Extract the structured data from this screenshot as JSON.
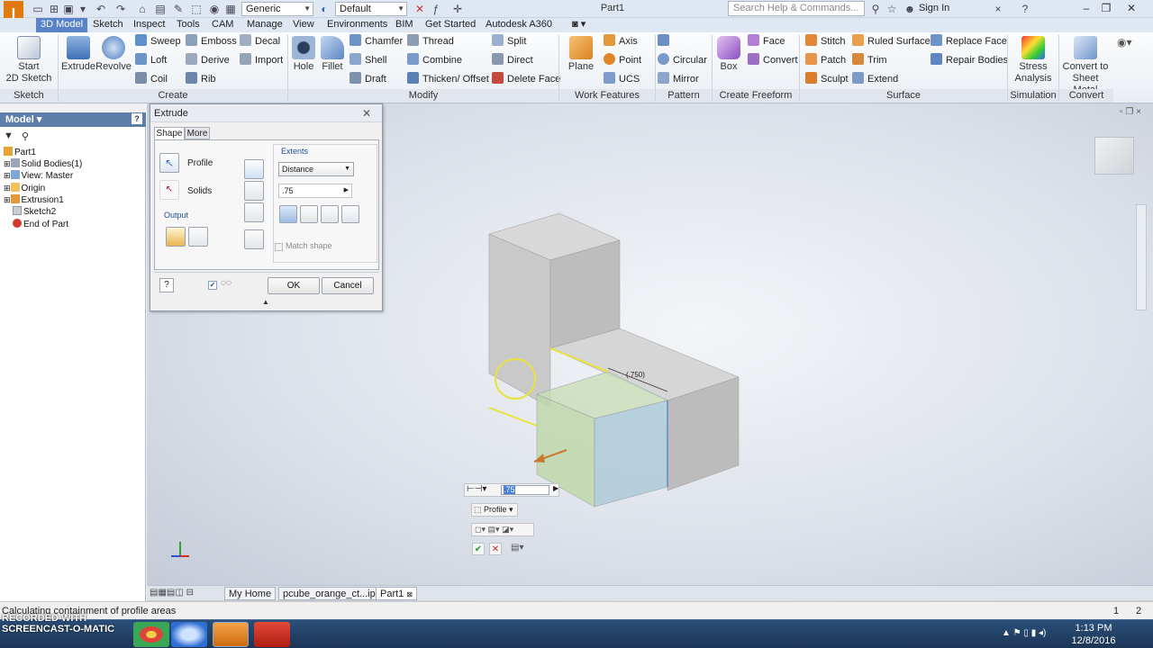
{
  "window": {
    "title": "Part1",
    "logo_letter": "I"
  },
  "quick_access": {
    "material": "Generic",
    "appearance": "Default"
  },
  "search": {
    "placeholder": "Search Help & Commands..."
  },
  "signin": "Sign In",
  "menu_tabs": [
    "3D Model",
    "Sketch",
    "Inspect",
    "Tools",
    "CAM",
    "Manage",
    "View",
    "Environments",
    "BIM",
    "Get Started",
    "Autodesk A360"
  ],
  "ribbon": {
    "sketch": {
      "start_label": "Start\n2D Sketch",
      "panel": "Sketch"
    },
    "create": {
      "panel": "Create",
      "extrude": "Extrude",
      "revolve": "Revolve",
      "sweep": "Sweep",
      "loft": "Loft",
      "coil": "Coil",
      "emboss": "Emboss",
      "derive": "Derive",
      "rib": "Rib",
      "decal": "Decal",
      "import": "Import"
    },
    "modify": {
      "panel": "Modify",
      "hole": "Hole",
      "fillet": "Fillet",
      "chamfer": "Chamfer",
      "shell": "Shell",
      "draft": "Draft",
      "thread": "Thread",
      "combine": "Combine",
      "thicken": "Thicken/ Offset",
      "split": "Split",
      "direct": "Direct",
      "delete_face": "Delete Face"
    },
    "work_features": {
      "panel": "Work Features",
      "plane": "Plane",
      "axis": "Axis",
      "point": "Point",
      "ucs": "UCS"
    },
    "pattern": {
      "panel": "Pattern",
      "circular": "Circular",
      "mirror": "Mirror"
    },
    "freeform": {
      "panel": "Create Freeform",
      "box": "Box",
      "face": "Face",
      "convert": "Convert"
    },
    "surface": {
      "panel": "Surface",
      "stitch": "Stitch",
      "patch": "Patch",
      "sculpt": "Sculpt",
      "ruled_surface": "Ruled Surface",
      "trim": "Trim",
      "extend": "Extend",
      "replace_face": "Replace Face",
      "repair_bodies": "Repair Bodies"
    },
    "simulation": {
      "panel": "Simulation",
      "stress": "Stress\nAnalysis"
    },
    "convert": {
      "panel": "Convert",
      "sheet_metal": "Convert to\nSheet Metal"
    }
  },
  "browser": {
    "title": "Model",
    "items": [
      "Part1",
      "Solid Bodies(1)",
      "View: Master",
      "Origin",
      "Extrusion1",
      "Sketch2",
      "End of Part"
    ]
  },
  "dialog": {
    "title": "Extrude",
    "tab_shape": "Shape",
    "tab_more": "More",
    "profile": "Profile",
    "solids": "Solids",
    "output": "Output",
    "extents": "Extents",
    "extents_type": "Distance",
    "distance": ".75",
    "match_shape": "Match shape",
    "ok": "OK",
    "cancel": "Cancel"
  },
  "viewport": {
    "dimension_label": "(.750)",
    "minitoolbar_value": ".75",
    "minitoolbar_profile": "Profile"
  },
  "doc_tabs": [
    "My Home",
    "pcube_orange_ct...ipt",
    "Part1"
  ],
  "status": {
    "message": "Calculating containment of profile areas",
    "page1": "1",
    "page2": "2"
  },
  "taskbar": {
    "time": "1:13 PM",
    "date": "12/8/2016",
    "watermark": "RECORDED WITH\nSCREENCAST-O-MATIC"
  }
}
